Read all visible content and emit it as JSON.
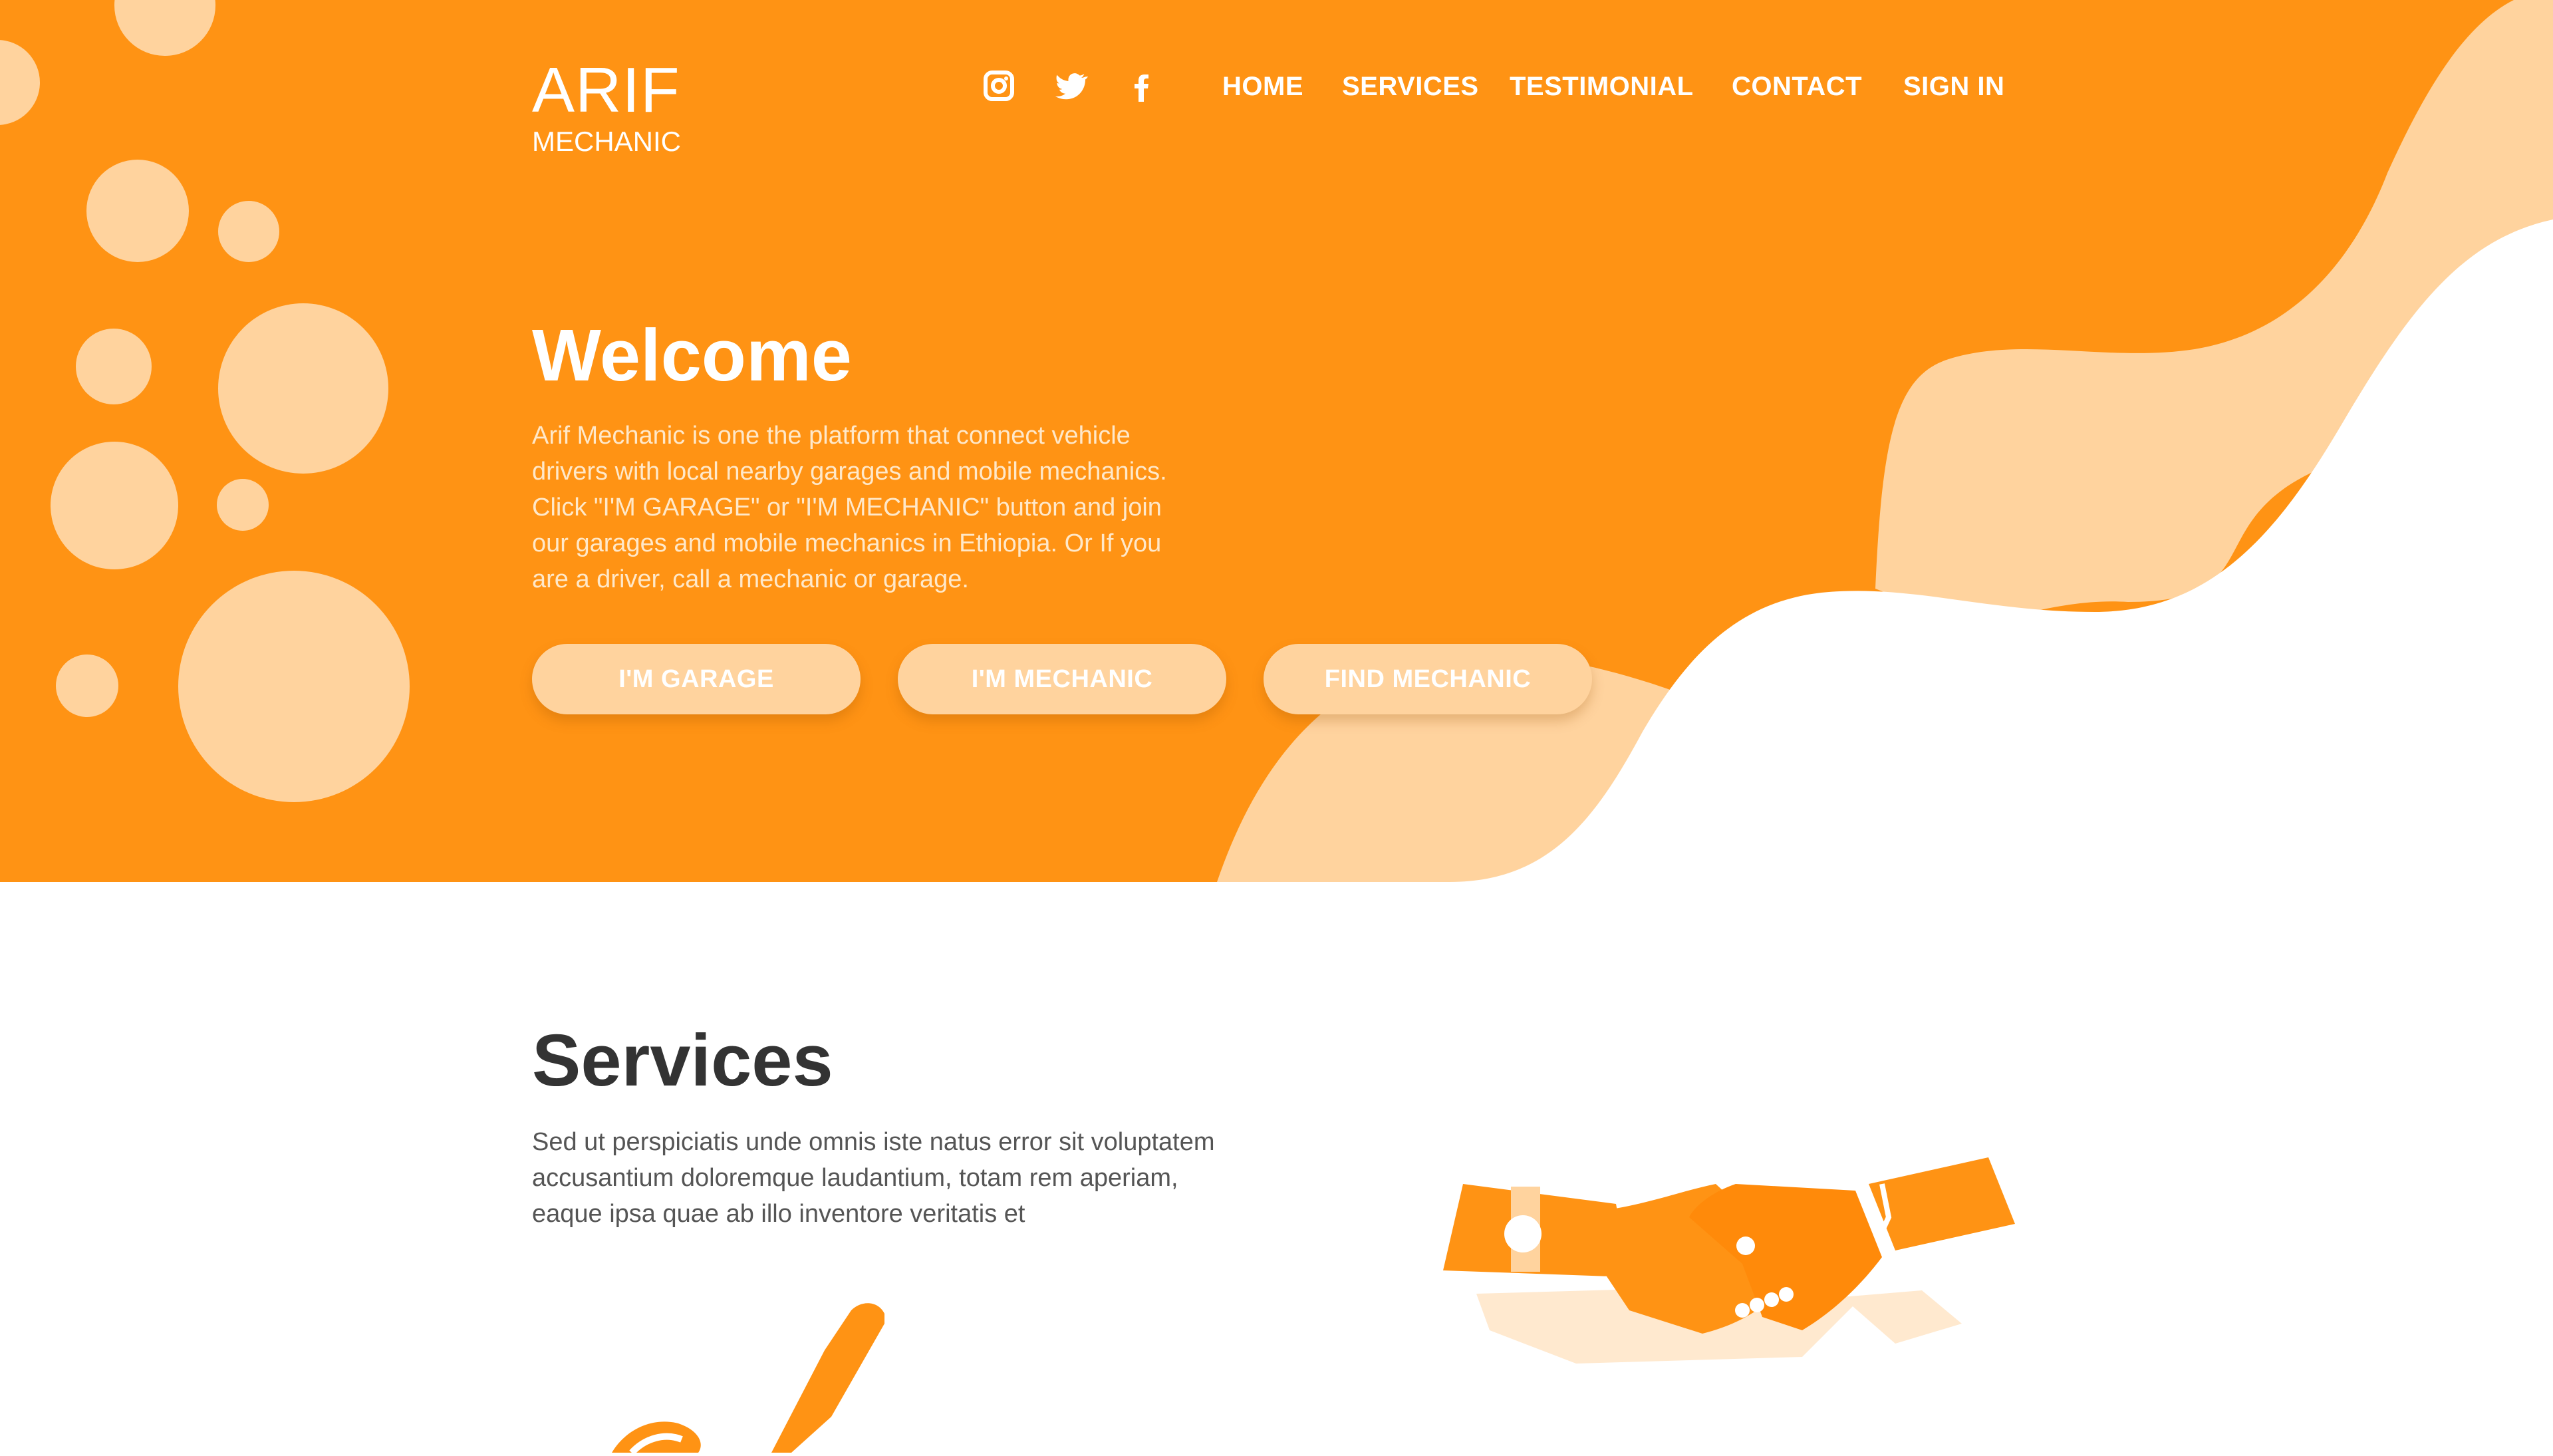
{
  "brand": {
    "name": "ARIF",
    "subtitle": "MECHANIC"
  },
  "social": [
    "instagram-icon",
    "twitter-icon",
    "facebook-icon"
  ],
  "nav": {
    "items": [
      "HOME",
      "SERVICES",
      "TESTIMONIAL",
      "CONTACT",
      "SIGN IN"
    ]
  },
  "hero": {
    "title": "Welcome",
    "text": "Arif Mechanic is one the platform that connect vehicle drivers with local nearby garages and mobile mechanics. Click \"I'M GARAGE\" or \"I'M MECHANIC\" button and join our garages and mobile mechanics in Ethiopia. Or If you are a driver, call a mechanic or garage.",
    "buttons": [
      "I'M GARAGE",
      "I'M MECHANIC",
      "FIND MECHANIC"
    ]
  },
  "services": {
    "title": "Services",
    "text": "Sed ut perspiciatis unde omnis iste natus error sit voluptatem accusantium doloremque laudantium, totam rem aperiam, eaque ipsa quae ab illo inventore veritatis et"
  },
  "colors": {
    "primary": "#FF9314",
    "light": "#FFD39E",
    "white": "#FFFFFF",
    "heading": "#333333",
    "body_text": "#555555"
  }
}
